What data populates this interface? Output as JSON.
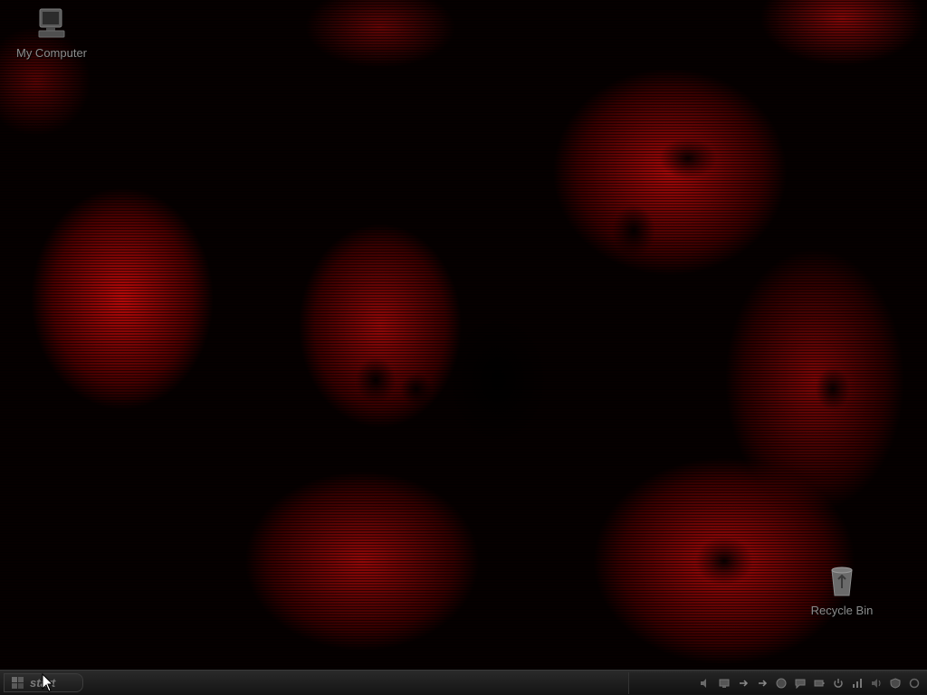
{
  "desktop": {
    "icons": [
      {
        "label": "My Computer",
        "icon": "my-computer-icon"
      },
      {
        "label": "Recycle Bin",
        "icon": "recycle-bin-icon"
      }
    ],
    "wallpaper": "skulls",
    "accent_color": "#c80a0a"
  },
  "taskbar": {
    "start_label": "start",
    "tray_icons": [
      "volume-icon",
      "network-icon",
      "arrow-icon",
      "arrow-icon",
      "antivirus-icon",
      "chat-icon",
      "battery-icon",
      "power-icon",
      "network-icon",
      "speaker-icon",
      "shield-icon",
      "update-icon"
    ],
    "color": "#1e1e1e"
  }
}
